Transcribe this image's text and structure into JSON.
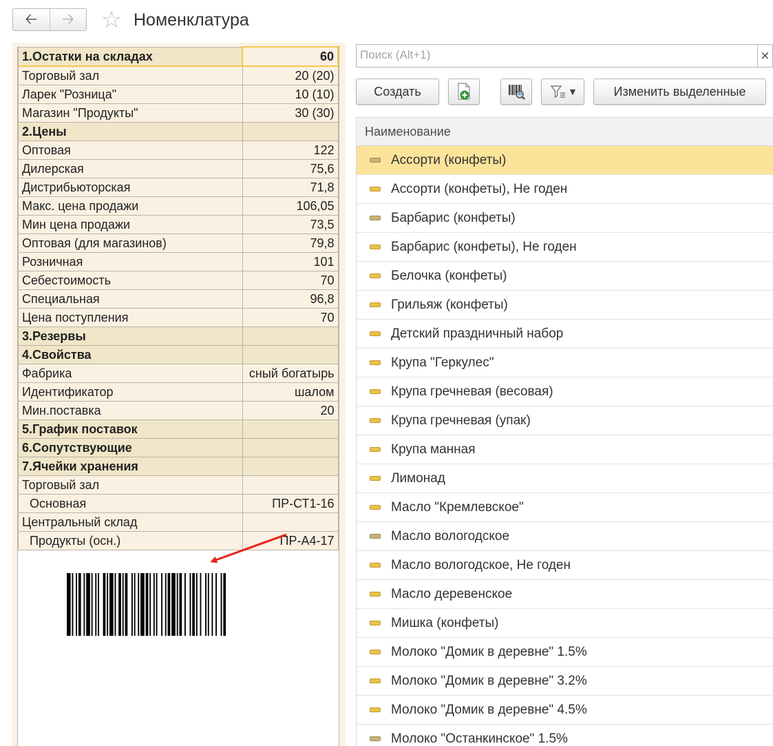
{
  "window": {
    "title": "Номенклатура",
    "nav_back_icon": "arrow-left-icon",
    "nav_forward_icon": "arrow-right-icon",
    "favorite_icon": "star-icon"
  },
  "properties": [
    {
      "label": "1.Остатки на складах",
      "value": "60",
      "type": "header"
    },
    {
      "label": "Торговый зал",
      "value": "20 (20)",
      "type": "item"
    },
    {
      "label": "Ларек \"Розница\"",
      "value": "10 (10)",
      "type": "item"
    },
    {
      "label": "Магазин \"Продукты\"",
      "value": "30 (30)",
      "type": "item"
    },
    {
      "label": "2.Цены",
      "value": "",
      "type": "header"
    },
    {
      "label": "Оптовая",
      "value": "122",
      "type": "item"
    },
    {
      "label": "Дилерская",
      "value": "75,6",
      "type": "item"
    },
    {
      "label": "Дистрибьюторская",
      "value": "71,8",
      "type": "item"
    },
    {
      "label": "Макс. цена продажи",
      "value": "106,05",
      "type": "item"
    },
    {
      "label": "Мин цена продажи",
      "value": "73,5",
      "type": "item"
    },
    {
      "label": "Оптовая (для магазинов)",
      "value": "79,8",
      "type": "item"
    },
    {
      "label": "Розничная",
      "value": "101",
      "type": "item"
    },
    {
      "label": "Себестоимость",
      "value": "70",
      "type": "item"
    },
    {
      "label": "Специальная",
      "value": "96,8",
      "type": "item"
    },
    {
      "label": "Цена поступления",
      "value": "70",
      "type": "item"
    },
    {
      "label": "3.Резервы",
      "value": "",
      "type": "header"
    },
    {
      "label": "4.Свойства",
      "value": "",
      "type": "header"
    },
    {
      "label": "Фабрика",
      "value": "сный богатырь",
      "type": "item"
    },
    {
      "label": "Идентификатор",
      "value": "шалом",
      "type": "item"
    },
    {
      "label": "Мин.поставка",
      "value": "20",
      "type": "item"
    },
    {
      "label": "5.График поставок",
      "value": "",
      "type": "header"
    },
    {
      "label": "6.Сопутствующие",
      "value": "",
      "type": "header"
    },
    {
      "label": "7.Ячейки хранения",
      "value": "",
      "type": "header"
    },
    {
      "label": "Торговый зал",
      "value": "",
      "type": "item"
    },
    {
      "label": "Основная",
      "value": "ПР-СТ1-16",
      "type": "indent"
    },
    {
      "label": "Центральный склад",
      "value": "",
      "type": "item"
    },
    {
      "label": "Продукты (осн.)",
      "value": "ПР-А4-17",
      "type": "indent"
    }
  ],
  "barcode_icon": "barcode-image",
  "annotation_icon": "red-arrow-icon",
  "search": {
    "placeholder": "Поиск (Alt+1)",
    "value": "",
    "clear_label": "×"
  },
  "toolbar": {
    "create_label": "Создать",
    "add_icon": "add-document-icon",
    "barcode_search_icon": "barcode-search-icon",
    "filter_icon": "filter-icon",
    "filter_dropdown_icon": "chevron-down-icon",
    "change_selected_label": "Изменить выделенные"
  },
  "list": {
    "column_header": "Наименование",
    "items": [
      {
        "name": "Ассорти (конфеты)",
        "selected": true,
        "dim": true
      },
      {
        "name": "Ассорти (конфеты), Не годен",
        "selected": false,
        "dim": false
      },
      {
        "name": "Барбарис (конфеты)",
        "selected": false,
        "dim": true
      },
      {
        "name": "Барбарис (конфеты), Не годен",
        "selected": false,
        "dim": false
      },
      {
        "name": "Белочка (конфеты)",
        "selected": false,
        "dim": false
      },
      {
        "name": "Грильяж (конфеты)",
        "selected": false,
        "dim": false
      },
      {
        "name": "Детский праздничный набор",
        "selected": false,
        "dim": false
      },
      {
        "name": "Крупа \"Геркулес\"",
        "selected": false,
        "dim": false
      },
      {
        "name": "Крупа гречневая (весовая)",
        "selected": false,
        "dim": false
      },
      {
        "name": "Крупа гречневая (упак)",
        "selected": false,
        "dim": false
      },
      {
        "name": "Крупа манная",
        "selected": false,
        "dim": false
      },
      {
        "name": "Лимонад",
        "selected": false,
        "dim": false
      },
      {
        "name": "Масло \"Кремлевское\"",
        "selected": false,
        "dim": false
      },
      {
        "name": "Масло вологодское",
        "selected": false,
        "dim": true
      },
      {
        "name": "Масло вологодское, Не годен",
        "selected": false,
        "dim": false
      },
      {
        "name": "Масло деревенское",
        "selected": false,
        "dim": false
      },
      {
        "name": "Мишка (конфеты)",
        "selected": false,
        "dim": false
      },
      {
        "name": "Молоко \"Домик в деревне\" 1.5%",
        "selected": false,
        "dim": false
      },
      {
        "name": "Молоко \"Домик в деревне\" 3.2%",
        "selected": false,
        "dim": false
      },
      {
        "name": "Молоко \"Домик в деревне\" 4.5%",
        "selected": false,
        "dim": false
      },
      {
        "name": "Молоко \"Останкинское\" 1.5%",
        "selected": false,
        "dim": true
      }
    ]
  },
  "colors": {
    "selection": "#fbe39a",
    "panel_bg": "#fbf1e6",
    "cell_bg": "#fbf1e2",
    "section_bg": "#f1e6c8",
    "accent_border": "#f2c94c",
    "arrow": "#e5221e"
  }
}
